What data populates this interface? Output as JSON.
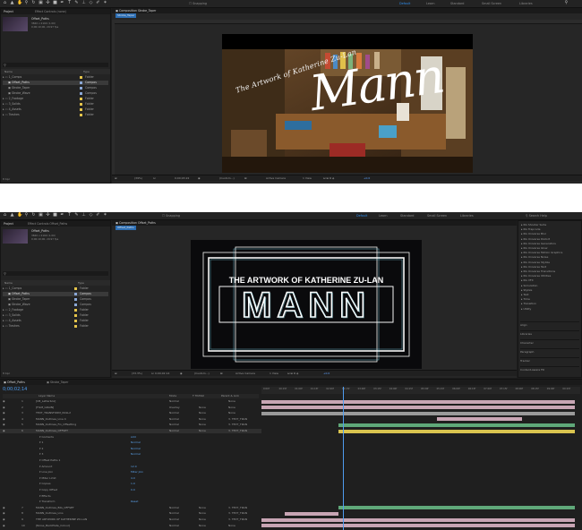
{
  "top": {
    "workspaces": [
      "Default",
      "Learn",
      "Standard",
      "Small Screen",
      "Libraries"
    ],
    "snapping": "Snapping",
    "project_tab": "Project",
    "effect_controls_tab": "Effect Controls (none)",
    "comp_name": "Offset_Paths",
    "comp_meta": [
      "3840 x 2160 (1.00)",
      "0;00;10;00, 29.97 fps"
    ],
    "items": [
      {
        "name": "1_Comps",
        "type": "Folder",
        "color": "#e3c34a"
      },
      {
        "name": "Offset_Paths",
        "type": "Compos",
        "color": "#8aa7d6",
        "selected": true
      },
      {
        "name": "Stroke_Taper",
        "type": "Compos",
        "color": "#8aa7d6"
      },
      {
        "name": "Stroke_Wave",
        "type": "Compos",
        "color": "#8aa7d6"
      },
      {
        "name": "2_Footage",
        "type": "Folder",
        "color": "#e3c34a"
      },
      {
        "name": "3_Solids",
        "type": "Folder",
        "color": "#e3c34a"
      },
      {
        "name": "4_Assets",
        "type": "Folder",
        "color": "#e3c34a"
      },
      {
        "name": "Trashes",
        "type": "Folder",
        "color": "#e3c34a"
      }
    ],
    "col_name": "Name",
    "col_type": "Type",
    "bpc": "8 bpc",
    "viewer_tab": "Composition Stroke_Taper",
    "viewer_subtab": "Stroke_Taper",
    "zoom": "(39%)",
    "timecode": "0;00;03;22",
    "resolution": "(Custom...)",
    "camera": "Active Camera",
    "view": "1 View",
    "exposure": "+0.0",
    "frame_title": "The Artwork of Katherine Zu-Lan",
    "frame_word": "Mann"
  },
  "bottom": {
    "workspaces": [
      "Default",
      "Learn",
      "Standard",
      "Small Screen",
      "Libraries"
    ],
    "snapping": "Snapping",
    "search_help": "Search Help",
    "project_tab": "Project",
    "effect_controls_tab": "Effect Controls Offset_Paths",
    "viewer_tab": "Composition Offset_Paths",
    "viewer_subtab": "Offset_Paths",
    "comp_name": "Offset_Paths",
    "comp_meta": [
      "3840 x 2160 (1.00)",
      "0;00;10;00, 29.97 fps"
    ],
    "items": [
      {
        "name": "1_Comps",
        "type": "Folder",
        "color": "#e3c34a"
      },
      {
        "name": "Offset_Paths",
        "type": "Compos",
        "color": "#8aa7d6",
        "selected": true
      },
      {
        "name": "Stroke_Taper",
        "type": "Compos",
        "color": "#8aa7d6"
      },
      {
        "name": "Stroke_Wave",
        "type": "Compos",
        "color": "#8aa7d6"
      },
      {
        "name": "2_Footage",
        "type": "Folder",
        "color": "#e3c34a"
      },
      {
        "name": "3_Solids",
        "type": "Folder",
        "color": "#e3c34a"
      },
      {
        "name": "4_Assets",
        "type": "Folder",
        "color": "#e3c34a"
      },
      {
        "name": "Trashes",
        "type": "Folder",
        "color": "#e3c34a"
      }
    ],
    "col_name": "Name",
    "col_type": "Type",
    "bpc": "8 bpc",
    "zoom": "(33.3%)",
    "timecode": "0;00;02;14",
    "resolution": "(Custom...)",
    "camera": "Active Camera",
    "view": "1 View",
    "exposure": "+0.0",
    "frame_title": "The Artwork of Katherine Zu-Lan",
    "frame_word": "MANN",
    "effects": [
      "RG Shooter Suite",
      "RG Trapcode",
      "RG Universe Blur",
      "RG Universe Distort",
      "RG Universe Generators",
      "RG Universe Glow",
      "RG Universe Motion Graphics",
      "RG Universe Noise",
      "RG Universe Stylize",
      "RG Universe Text",
      "RG Universe Transitions",
      "RG Universe Utilities",
      "RG VFX",
      "Simulation",
      "Stylize",
      "Text",
      "Time",
      "Transition",
      "Utility"
    ],
    "side_panels": [
      "Align",
      "Libraries",
      "Character",
      "Paragraph",
      "Tracker",
      "Content-Aware Fill"
    ],
    "tl_tabs": [
      "Offset_Paths",
      "Stroke_Taper"
    ],
    "tl_timecode": "0;00;02;14",
    "tl_cols": [
      "Layer Name",
      "Mode",
      "T TrkMat",
      "Parent & Link"
    ],
    "ticks": [
      "0:00f",
      "00:15f",
      "01:00f",
      "01:15f",
      "02:00f",
      "02:15f",
      "03:00f",
      "03:15f",
      "04:00f",
      "04:15f",
      "05:00f",
      "05:15f",
      "06:00f",
      "06:15f",
      "07:00f",
      "07:15f",
      "08:00f",
      "08:15f",
      "09:00f",
      "09:15f"
    ],
    "layers": [
      {
        "num": "1",
        "name": "[CB_Letterbox]",
        "mode": "Normal",
        "trk": "",
        "parent": "None"
      },
      {
        "num": "2",
        "name": "[FILM_GRAIN]",
        "mode": "Overlay",
        "trk": "None",
        "parent": "None"
      },
      {
        "num": "3",
        "name": "TEXT_TRANSFORM_NULL2",
        "mode": "Normal",
        "trk": "None",
        "parent": "None"
      },
      {
        "num": "4",
        "name": "MANN_Outlines_Line 4",
        "mode": "Normal",
        "trk": "None",
        "parent": "3. TEXT_TRAN"
      },
      {
        "num": "5",
        "name": "MANN_Outlines_Fin_Offsetting",
        "mode": "Normal",
        "trk": "None",
        "parent": "3. TEXT_TRAN"
      },
      {
        "num": "6",
        "name": "MANN_Outlines_OFFSET",
        "mode": "Normal",
        "trk": "None",
        "parent": "3. TEXT_TRAN"
      },
      {
        "num": "",
        "name": "Contents",
        "mode": "Add",
        "trk": "",
        "parent": ""
      },
      {
        "num": "",
        "name": "1",
        "mode": "Normal",
        "trk": "",
        "parent": ""
      },
      {
        "num": "",
        "name": "2",
        "mode": "Normal",
        "trk": "",
        "parent": ""
      },
      {
        "num": "",
        "name": "3",
        "mode": "Normal",
        "trk": "",
        "parent": ""
      },
      {
        "num": "",
        "name": "Offset Paths 1",
        "mode": "",
        "trk": "",
        "parent": ""
      },
      {
        "num": "",
        "name": "Amount",
        "mode": "12.0",
        "trk": "",
        "parent": ""
      },
      {
        "num": "",
        "name": "Line Join",
        "mode": "Miter Join",
        "trk": "",
        "parent": ""
      },
      {
        "num": "",
        "name": "Miter Limit",
        "mode": "4.0",
        "trk": "",
        "parent": ""
      },
      {
        "num": "",
        "name": "Copies",
        "mode": "1.0",
        "trk": "",
        "parent": ""
      },
      {
        "num": "",
        "name": "Copy Offset",
        "mode": "0.0",
        "trk": "",
        "parent": ""
      },
      {
        "num": "",
        "name": "Effects",
        "mode": "",
        "trk": "",
        "parent": ""
      },
      {
        "num": "",
        "name": "Transform",
        "mode": "Reset",
        "trk": "",
        "parent": ""
      },
      {
        "num": "7",
        "name": "MANN_Outlines_BIG_OFFSET",
        "mode": "Normal",
        "trk": "None",
        "parent": "3. TEXT_TRAN"
      },
      {
        "num": "8",
        "name": "MANN_Outlines_Lins",
        "mode": "Normal",
        "trk": "None",
        "parent": "3. TEXT_TRAN"
      },
      {
        "num": "9",
        "name": "THE ARTWORK OF KATHERINE ZU-LAN",
        "mode": "Normal",
        "trk": "None",
        "parent": "3. TEXT_TRAN"
      },
      {
        "num": "10",
        "name": "[Noise_BackPlate_Colour]",
        "mode": "Normal",
        "trk": "None",
        "parent": "None"
      }
    ]
  }
}
